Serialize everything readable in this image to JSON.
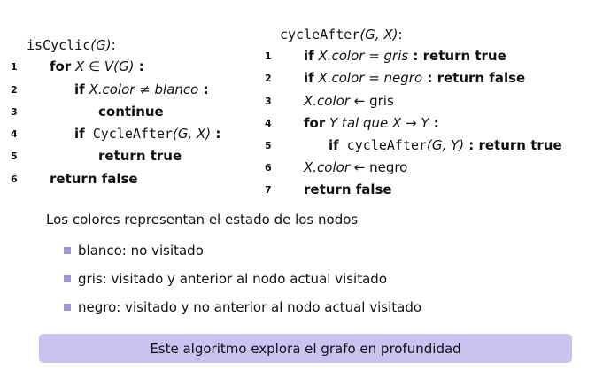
{
  "left_algorithm": {
    "title_name": "isCyclic",
    "title_args": "(G)",
    "title_colon": ":",
    "lines": [
      {
        "num": "1",
        "kw": "for",
        "a": " X ∈ V(G)",
        "b": " :"
      },
      {
        "num": "2",
        "kw": "if",
        "a": " X.color ≠ blanco",
        "b": " :"
      },
      {
        "num": "3",
        "kw": "continue"
      },
      {
        "num": "4",
        "kw": "if",
        "mono": " CycleAfter",
        "a": "(G, X)",
        "b": " :"
      },
      {
        "num": "5",
        "kw": "return true"
      },
      {
        "num": "6",
        "kw": "return false"
      }
    ]
  },
  "right_algorithm": {
    "title_name": "cycleAfter",
    "title_args": "(G, X)",
    "title_colon": ":",
    "lines": [
      {
        "num": "1",
        "kw": "if",
        "a": " X.color = gris",
        "b": " : return true"
      },
      {
        "num": "2",
        "kw": "if",
        "a": " X.color = negro",
        "b": " : return false"
      },
      {
        "num": "3",
        "a": "X.color",
        "c": " ← gris"
      },
      {
        "num": "4",
        "kw": "for",
        "a": " Y tal que X → Y",
        "b": " :"
      },
      {
        "num": "5",
        "kw": "if",
        "mono": " cycleAfter",
        "a": "(G, Y)",
        "b": " : return true"
      },
      {
        "num": "6",
        "a": "X.color",
        "c": " ← negro"
      },
      {
        "num": "7",
        "kw": "return false"
      }
    ]
  },
  "legend": {
    "intro": "Los colores representan el estado de los nodos",
    "items": [
      "blanco: no visitado",
      "gris: visitado y anterior al nodo actual visitado",
      "negro: visitado y no anterior al nodo actual visitado"
    ]
  },
  "summary_box": "Este algoritmo explora el grafo en profundidad",
  "colors": {
    "bullet": "#9b96d8",
    "box_background": "#c9c3f1"
  }
}
